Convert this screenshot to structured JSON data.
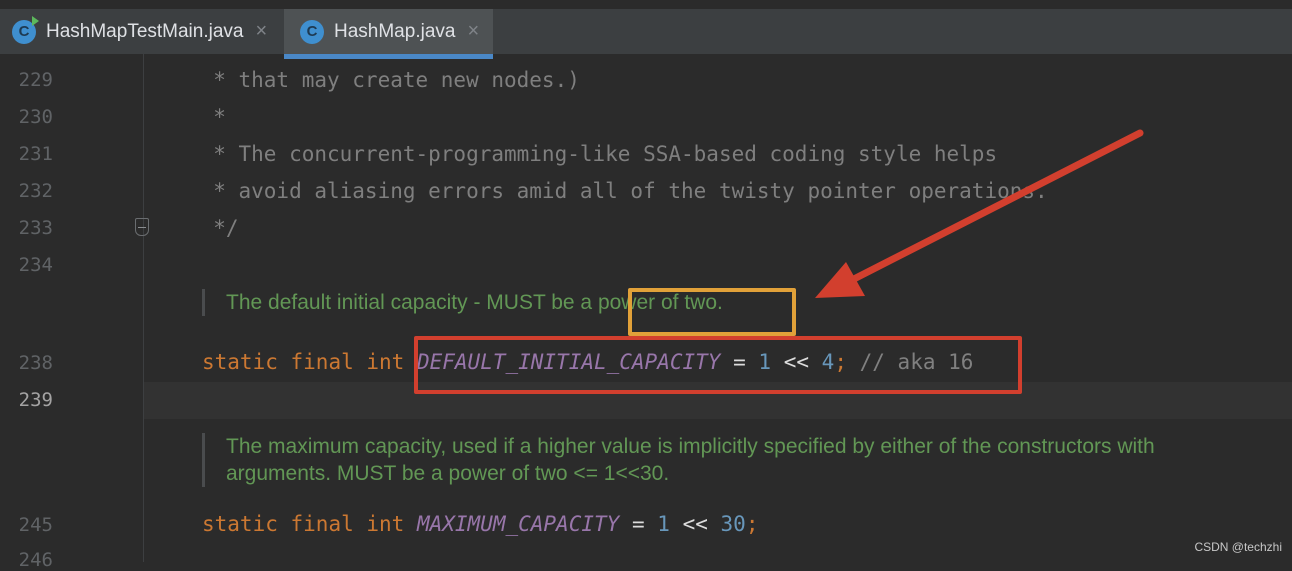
{
  "tabs": [
    {
      "label": "HashMapTestMain.java",
      "icon": "java-class-run-icon",
      "active": false
    },
    {
      "label": "HashMap.java",
      "icon": "java-class-icon",
      "active": true
    }
  ],
  "file_icon_letter": "C",
  "close_glyph": "×",
  "gutter": {
    "line_229": "229",
    "line_230": "230",
    "line_231": "231",
    "line_232": "232",
    "line_233": "233",
    "line_234": "234",
    "line_238": "238",
    "line_239": "239",
    "line_245": "245",
    "line_246": "246"
  },
  "code": {
    "l229": "     * that may create new nodes.)",
    "l230": "     *",
    "l231": "     * The concurrent-programming-like SSA-based coding style helps",
    "l232": "     * avoid aliasing errors amid all of the twisty pointer operations.",
    "l233": "     */",
    "l238": {
      "kw1": "static",
      "kw2": "final",
      "kw3": "int",
      "name": "DEFAULT_INITIAL_CAPACITY",
      "eq": "=",
      "n1": "1",
      "shift": "<<",
      "n2": "4",
      "semi": ";",
      "comment": "// aka 16"
    },
    "l245": {
      "kw1": "static",
      "kw2": "final",
      "kw3": "int",
      "name": "MAXIMUM_CAPACITY",
      "eq": "=",
      "n1": "1",
      "shift": "<<",
      "n2": "30",
      "semi": ";"
    }
  },
  "docs": {
    "default_capacity": "The default initial capacity - MUST be a power of two.",
    "max_capacity_line1": "The maximum capacity, used if a higher value is implicitly specified by either of the constructors with",
    "max_capacity_line2": "arguments. MUST be a power of two <= 1<<30."
  },
  "annotations": {
    "orange_box": "#e1a139",
    "red_box": "#d23f2e",
    "arrow": "#d23f2e"
  },
  "watermark": "CSDN @techzhi",
  "colors": {
    "background": "#2b2b2b",
    "keyword": "#cc7832",
    "constant": "#9876aa",
    "number": "#6897bb",
    "doc": "#629755"
  }
}
